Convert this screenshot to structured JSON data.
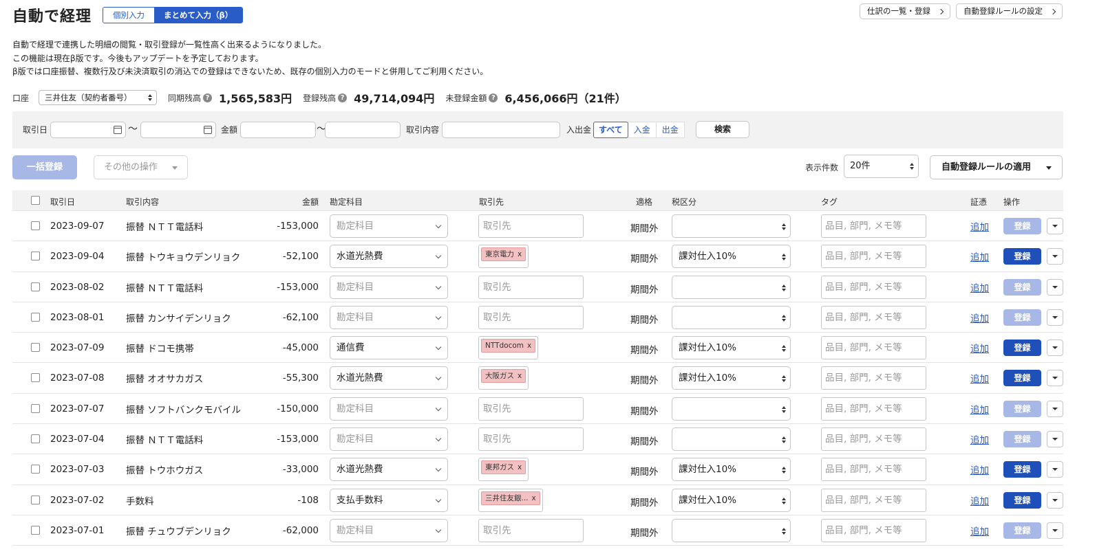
{
  "header": {
    "title": "自動で経理",
    "mode_single": "個別入力",
    "mode_bulk": "まとめて入力（β）",
    "link_journal": "仕訳の一覧・登録",
    "link_rules": "自動登録ルールの設定"
  },
  "description": [
    "自動で経理で連携した明細の閲覧・取引登録が一覧性高く出来るようになりました。",
    "この機能は現在β版です。今後もアップデートを予定しております。",
    "β版では口座振替、複数行及び未決済取引の消込での登録はできないため、既存の個別入力のモードと併用してご利用ください。"
  ],
  "account": {
    "label": "口座",
    "selected": "三井住友（契約者番号）",
    "sync_balance_label": "同期残高",
    "sync_balance": "1,565,583円",
    "registered_balance_label": "登録残高",
    "registered_balance": "49,714,094円",
    "unregistered_label": "未登録金額",
    "unregistered": "6,456,066円（21件）"
  },
  "filter": {
    "date_label": "取引日",
    "tilde1": "〜",
    "amount_label": "金額",
    "tilde2": "〜",
    "content_label": "取引内容",
    "inout_label": "入出金",
    "seg_all": "すべて",
    "seg_in": "入金",
    "seg_out": "出金",
    "search": "検索"
  },
  "toolbar": {
    "bulk_register": "一括登録",
    "other_ops": "その他の操作",
    "per_page_label": "表示件数",
    "per_page": "20件",
    "apply_rules": "自動登録ルールの適用"
  },
  "table": {
    "headers": {
      "date": "取引日",
      "content": "取引内容",
      "amount": "金額",
      "account": "勘定科目",
      "partner": "取引先",
      "qualified": "適格",
      "tax": "税区分",
      "tag": "タグ",
      "evidence": "証憑",
      "ops": "操作"
    },
    "placeholders": {
      "account": "勘定科目",
      "partner": "取引先",
      "tag": "品目, 部門, メモ等"
    },
    "add_label": "追加",
    "register_label": "登録",
    "rows": [
      {
        "date": "2023-09-07",
        "content": "振替 ＮＴＴ電話料",
        "amount": "-153,000",
        "account": "",
        "partner": "",
        "qualified": "期間外",
        "tax": ""
      },
      {
        "date": "2023-09-04",
        "content": "振替 トウキョウデンリョク",
        "amount": "-52,100",
        "account": "水道光熱費",
        "partner": "東京電力",
        "qualified": "期間外",
        "tax": "課対仕入10%"
      },
      {
        "date": "2023-08-02",
        "content": "振替 ＮＴＴ電話料",
        "amount": "-153,000",
        "account": "",
        "partner": "",
        "qualified": "期間外",
        "tax": ""
      },
      {
        "date": "2023-08-01",
        "content": "振替 カンサイデンリョク",
        "amount": "-62,100",
        "account": "",
        "partner": "",
        "qualified": "期間外",
        "tax": ""
      },
      {
        "date": "2023-07-09",
        "content": "振替 ドコモ携帯",
        "amount": "-45,000",
        "account": "通信費",
        "partner": "NTTdocom",
        "qualified": "期間外",
        "tax": "課対仕入10%"
      },
      {
        "date": "2023-07-08",
        "content": "振替 オオサカガス",
        "amount": "-55,300",
        "account": "水道光熱費",
        "partner": "大阪ガス",
        "qualified": "期間外",
        "tax": "課対仕入10%"
      },
      {
        "date": "2023-07-07",
        "content": "振替 ソフトバンクモバイル",
        "amount": "-150,000",
        "account": "",
        "partner": "",
        "qualified": "期間外",
        "tax": ""
      },
      {
        "date": "2023-07-04",
        "content": "振替 ＮＴＴ電話料",
        "amount": "-153,000",
        "account": "",
        "partner": "",
        "qualified": "期間外",
        "tax": ""
      },
      {
        "date": "2023-07-03",
        "content": "振替 トウホウガス",
        "amount": "-33,000",
        "account": "水道光熱費",
        "partner": "東邦ガス",
        "qualified": "期間外",
        "tax": "課対仕入10%"
      },
      {
        "date": "2023-07-02",
        "content": "手数料",
        "amount": "-108",
        "account": "支払手数料",
        "partner": "三井住友銀...",
        "qualified": "期間外",
        "tax": "課対仕入10%"
      },
      {
        "date": "2023-07-01",
        "content": "振替 チュウブデンリョク",
        "amount": "-62,000",
        "account": "",
        "partner": "",
        "qualified": "期間外",
        "tax": ""
      }
    ]
  }
}
